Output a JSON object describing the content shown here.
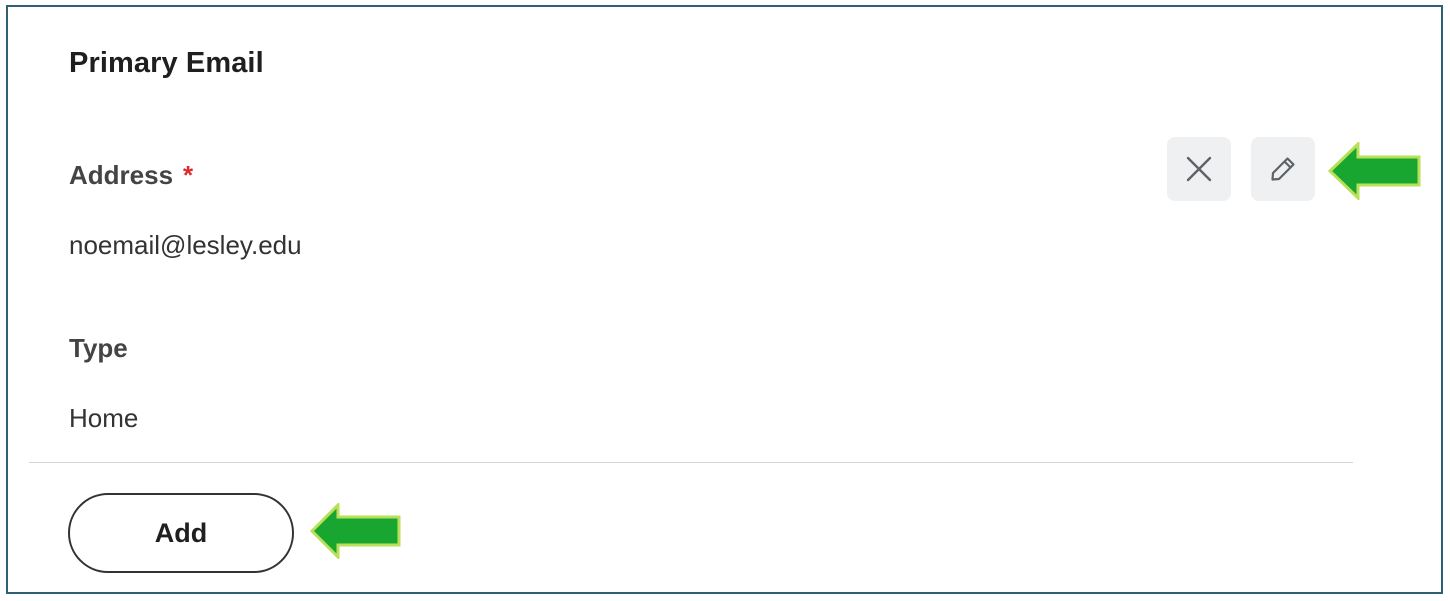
{
  "section": {
    "title": "Primary Email"
  },
  "address": {
    "label": "Address",
    "required_marker": "*",
    "value": "noemail@lesley.edu"
  },
  "type": {
    "label": "Type",
    "value": "Home"
  },
  "actions": {
    "close_icon": "close-icon",
    "edit_icon": "pencil-icon",
    "add_label": "Add"
  },
  "annotations": {
    "arrow_color": "#19a630",
    "arrow_border": "#b9e05a"
  },
  "colors": {
    "frame_border": "#2e5f73",
    "required_star": "#de2a2a",
    "icon_button_bg": "#eef0f2"
  }
}
